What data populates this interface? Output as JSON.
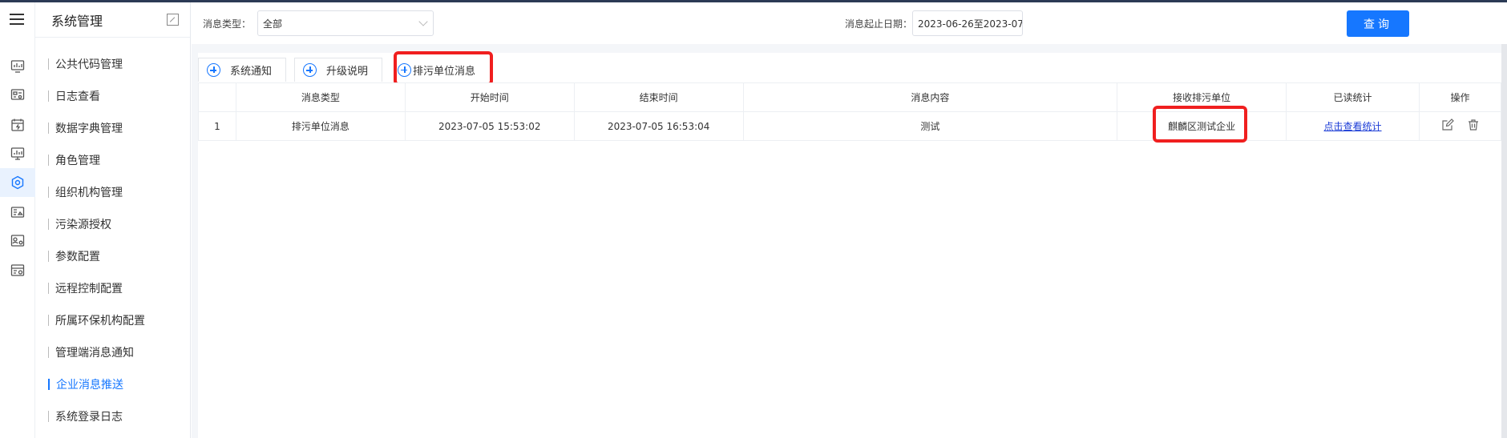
{
  "sidebar": {
    "title": "系统管理",
    "items": [
      {
        "label": "公共代码管理"
      },
      {
        "label": "日志查看"
      },
      {
        "label": "数据字典管理"
      },
      {
        "label": "角色管理"
      },
      {
        "label": "组织机构管理"
      },
      {
        "label": "污染源授权"
      },
      {
        "label": "参数配置"
      },
      {
        "label": "远程控制配置"
      },
      {
        "label": "所属环保机构配置"
      },
      {
        "label": "管理端消息通知"
      },
      {
        "label": "企业消息推送"
      },
      {
        "label": "系统登录日志"
      }
    ],
    "active_index": 10
  },
  "rail": {
    "icons": [
      "monitor-chart-icon",
      "dashboard-settings-icon",
      "calendar-alert-icon",
      "display-chart-icon",
      "gear-shield-icon",
      "image-card-icon",
      "profile-settings-icon",
      "window-settings-icon"
    ],
    "active_index": 4
  },
  "filters": {
    "type_label": "消息类型：",
    "type_value": "全部",
    "date_label": "消息起止日期：",
    "date_value": "2023-06-26至2023-07-",
    "query_label": "查询"
  },
  "tabs": [
    {
      "label": "系统通知"
    },
    {
      "label": "升级说明"
    },
    {
      "label": "排污单位消息"
    }
  ],
  "table": {
    "headers": [
      "",
      "消息类型",
      "开始时间",
      "结束时间",
      "消息内容",
      "接收排污单位",
      "已读统计",
      "操作"
    ],
    "rows": [
      {
        "index": "1",
        "type": "排污单位消息",
        "start": "2023-07-05 15:53:02",
        "end": "2023-07-05 16:53:04",
        "content": "测试",
        "receiver": "麒麟区测试企业",
        "read_stats": "点击查看统计"
      }
    ]
  },
  "colors": {
    "accent": "#1677ff",
    "highlight": "#f01f1f",
    "link": "#1a3bd6"
  }
}
